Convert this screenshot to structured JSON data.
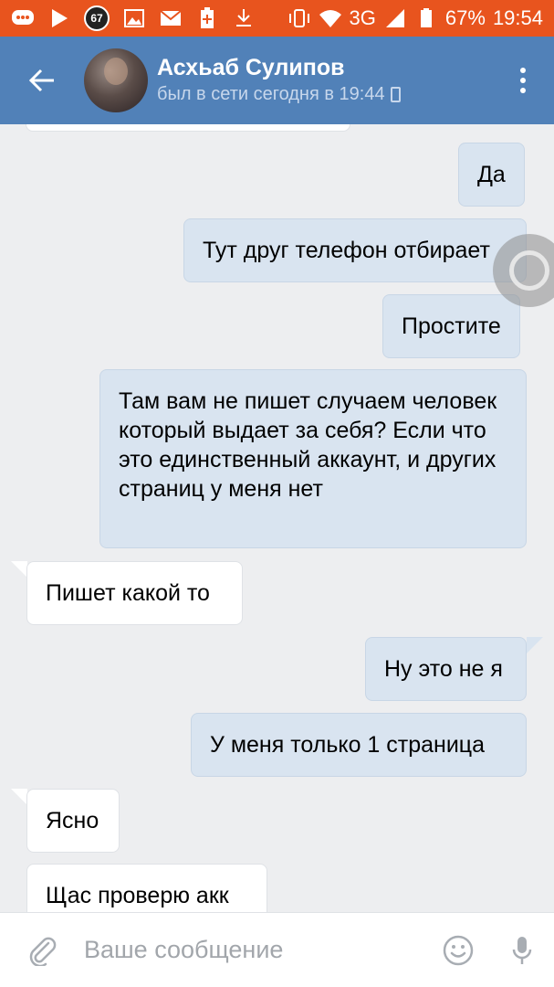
{
  "status_bar": {
    "badge": "67",
    "network": "3G",
    "battery": "67%",
    "time": "19:54"
  },
  "header": {
    "name": "Асхьаб Сулипов",
    "last_seen": "был в сети сегодня в 19:44"
  },
  "messages": [
    {
      "direction": "out",
      "text": "Да"
    },
    {
      "direction": "out",
      "text": "Тут друг телефон отбирает"
    },
    {
      "direction": "out",
      "text": "Простите"
    },
    {
      "direction": "out",
      "text": "Там вам не пишет случаем человек который выдает за себя? Если что это единственный аккаунт, и других страниц у меня нет"
    },
    {
      "direction": "in",
      "text": "Пишет какой то"
    },
    {
      "direction": "out",
      "text": "Ну это не я"
    },
    {
      "direction": "out",
      "text": "У меня только 1 страница"
    },
    {
      "direction": "in",
      "text": "Ясно"
    },
    {
      "direction": "in",
      "text": "Щас проверю акк"
    }
  ],
  "input": {
    "placeholder": "Ваше сообщение"
  },
  "colors": {
    "status_bar": "#e8541e",
    "header": "#5181b8",
    "outgoing_bubble": "#d9e4f0",
    "incoming_bubble": "#ffffff",
    "background": "#edeef0"
  }
}
